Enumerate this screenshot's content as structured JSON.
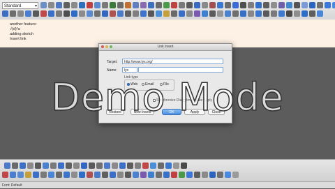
{
  "toolbar": {
    "style_select": "Standard",
    "row1_colors": [
      "#6b8fc7",
      "#8a8a8a",
      "#4f78c4",
      "#5f5f5f",
      "#8a8a8a",
      "#2f6fc0",
      "#c04040",
      "#5a8ad0",
      "#7a7a7a",
      "#3a7a3a",
      "#6b6b6b",
      "#c07030",
      "#5f7fbf",
      "#8a6bb0",
      "#3f6fbf",
      "#6a6a6a",
      "#4a9a4a",
      "#bf4040",
      "#7a7a7a",
      "#5a5a5a",
      "#3a6ac0",
      "#8a8a8a",
      "#a05050",
      "#3b78d0",
      "#6b6b6b",
      "#3a6ad8",
      "#4f4f4f",
      "#7e7e7e",
      "#3070c8",
      "#5e5e5e",
      "#8f8f8f",
      "#6e5ea8",
      "#3f88d0",
      "#555555",
      "#7a9ad8",
      "#2c65c0",
      "#707070",
      "#3b78d8",
      "#4a8ae0",
      "#9a9a9a"
    ],
    "row2_colors": [
      "#3c6fc4",
      "#6d6d6d",
      "#8a8a8a",
      "#4b7ed0",
      "#5a5a5a",
      "#c04848",
      "#3a70c8",
      "#7a7a7a",
      "#4f4f4f",
      "#2e6bc4",
      "#8c8c8c",
      "#5a8ad0",
      "#707070",
      "#3468c0",
      "#b05050",
      "#4a7ac8",
      "#606060",
      "#7f7f7f",
      "#3c74cc",
      "#585858",
      "#4b8fd8",
      "#c5a03a",
      "#6a6a6a",
      "#3a6ec8",
      "#8a8a8a",
      "#7a5ab0",
      "#3f7fd0",
      "#5c5c5c",
      "#969696",
      "#4a82d0",
      "#6f6f6f",
      "#3670c8",
      "#888888",
      "#3a78d0",
      "#5a5a5a",
      "#7a7a7a",
      "#3e7ad0",
      "#4a4a4a",
      "#8e8e8e",
      "#2f6ec8",
      "#5e5e5e",
      "#4a86d8"
    ]
  },
  "document": {
    "lines": [
      "another feature:",
      "√(d)²a",
      "adding sketch",
      "Insert link"
    ]
  },
  "dialog": {
    "title": "Link Insert",
    "target_label": "Target:",
    "target_value": "http://www.lyx.org/",
    "name_label": "Name:",
    "name_value": "lyx",
    "link_type_label": "Link type",
    "radio_web": "Web",
    "radio_email": "Email",
    "radio_file": "File",
    "checkbox_synchronize": "Synchronize Dialog",
    "checkbox_immediate": "Immediate Apply",
    "btn_restore": "Restore",
    "btn_new": "New Insets",
    "btn_ok": "OK",
    "btn_apply": "Apply",
    "btn_close": "Close",
    "selected_radio": "Web"
  },
  "watermark": "Demo Mode",
  "bottom_toolbar": {
    "row1_colors": [
      "#4a7ac8",
      "#6a6a6a",
      "#3a70c8",
      "#8a8a8a",
      "#5a5a5a",
      "#4a82d0",
      "#7a7a7a",
      "#3c6fc4",
      "#606060",
      "#888888",
      "#3468c0",
      "#5a5a5a",
      "#707070",
      "#4a7ac8",
      "#8a8a8a",
      "#3a70c8",
      "#5c5c5c",
      "#7f7f7f",
      "#c04848",
      "#4b8fd8",
      "#6a6a6a",
      "#3a78d0",
      "#969696",
      "#4a4a4a"
    ],
    "row2_colors": [
      "#c04848",
      "#4b7ed0",
      "#5a8ad0",
      "#c5a03a",
      "#3a70c8",
      "#7a7a7a",
      "#4a86d8",
      "#6a6a6a",
      "#3c74cc",
      "#8e8e8e",
      "#2f6ec8",
      "#b05050",
      "#4a7ac8",
      "#606060",
      "#3a6ec8",
      "#888888",
      "#5a5a5a",
      "#4a82d0",
      "#7a5ab0",
      "#3f7fd0",
      "#6f6f6f",
      "#3670c8",
      "#c04040",
      "#4a9a4a",
      "#3b78d8",
      "#5e5e5e",
      "#8a8a8a",
      "#2c65c0",
      "#707070",
      "#4a8ae0",
      "#9a9a9a"
    ]
  },
  "status": "Font: Default"
}
